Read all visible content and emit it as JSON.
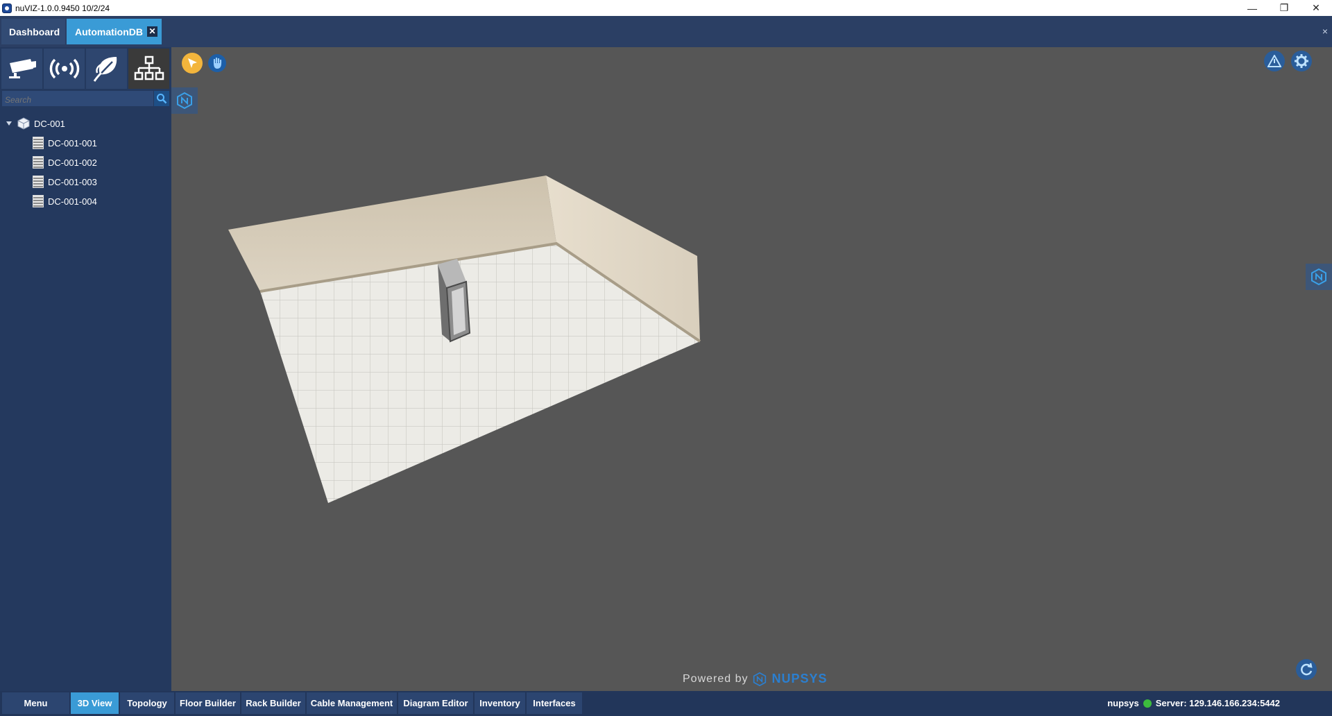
{
  "window": {
    "title": "nuVIZ-1.0.0.9450 10/2/24",
    "minimize_glyph": "—",
    "restore_glyph": "❐",
    "close_glyph": "✕"
  },
  "tabs": [
    {
      "label": "Dashboard",
      "active": false
    },
    {
      "label": "AutomationDB",
      "active": true,
      "close_glyph": "✕"
    }
  ],
  "panel_close_glyph": "×",
  "sidebar": {
    "tools": [
      {
        "icon": "security-camera-icon"
      },
      {
        "icon": "wireless-signal-icon"
      },
      {
        "icon": "leaf-icon"
      },
      {
        "icon": "hierarchy-icon",
        "active": true
      }
    ],
    "search": {
      "placeholder": "Search",
      "icon": "search-icon"
    },
    "tree": {
      "root": {
        "label": "DC-001",
        "expanded": true,
        "icon": "datacenter-icon"
      },
      "children": [
        {
          "label": "DC-001-001",
          "icon": "rack-icon"
        },
        {
          "label": "DC-001-002",
          "icon": "rack-icon"
        },
        {
          "label": "DC-001-003",
          "icon": "rack-icon"
        },
        {
          "label": "DC-001-004",
          "icon": "rack-icon"
        }
      ]
    }
  },
  "viewport": {
    "tools": [
      {
        "icon": "pointer-icon",
        "color": "#f3b53c"
      },
      {
        "icon": "hand-icon",
        "color": "#1d5fa8"
      }
    ],
    "top_right": [
      {
        "icon": "warning-icon"
      },
      {
        "icon": "gear-icon"
      }
    ],
    "powered_by": "Powered by",
    "brand": "NUPSYS",
    "refresh_icon": "refresh-icon"
  },
  "bottombar": {
    "buttons": [
      {
        "label": "Menu"
      },
      {
        "label": "3D View",
        "active": true
      },
      {
        "label": "Topology"
      },
      {
        "label": "Floor Builder"
      },
      {
        "label": "Rack Builder"
      },
      {
        "label": "Cable Management"
      },
      {
        "label": "Diagram Editor"
      },
      {
        "label": "Inventory"
      },
      {
        "label": "Interfaces"
      }
    ],
    "status": {
      "user": "nupsys",
      "server": "Server: 129.146.166.234:5442",
      "dot_color": "#3dbb3d"
    }
  },
  "colors": {
    "accent": "#3a9bd6",
    "sidebar": "#24395e",
    "viewport": "#565656"
  }
}
